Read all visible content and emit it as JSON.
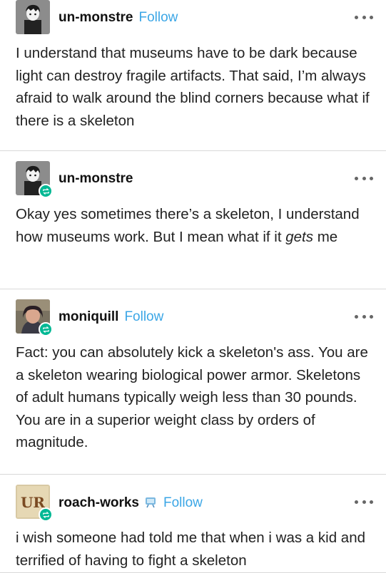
{
  "posts": [
    {
      "username": "un-monstre",
      "follow_label": "Follow",
      "text": "I understand that museums have to be dark because light can destroy fragile artifacts. That said, I’m always afraid to walk around the blind corners because what if there is a skeleton",
      "avatar_icon": "cartoon-boy-avatar",
      "reblogged": false
    },
    {
      "username": "un-monstre",
      "text_before": "Okay yes sometimes there’s a skeleton, I understand how museums work. But I mean what if it ",
      "text_emph": "gets",
      "text_after": " me",
      "avatar_icon": "cartoon-boy-avatar",
      "reblogged": true
    },
    {
      "username": "moniquill",
      "follow_label": "Follow",
      "text": "Fact: you can absolutely kick a skeleton's ass. You are a skeleton wearing biological power armor. Skeletons of adult humans typically weigh less than 30 pounds. You are in a superior weight class by orders of magnitude.",
      "avatar_icon": "photo-avatar",
      "reblogged": true
    },
    {
      "username": "roach-works",
      "follow_label": "Follow",
      "text": "i wish someone had told me that when i was a kid and terrified of having to fight a skeleton",
      "avatar_icon": "monogram-avatar",
      "avatar_text": "UR",
      "reblogged": true
    }
  ],
  "colors": {
    "follow": "#3ba6e6",
    "reblog_badge": "#00b894",
    "divider": "#d9d9d9"
  }
}
